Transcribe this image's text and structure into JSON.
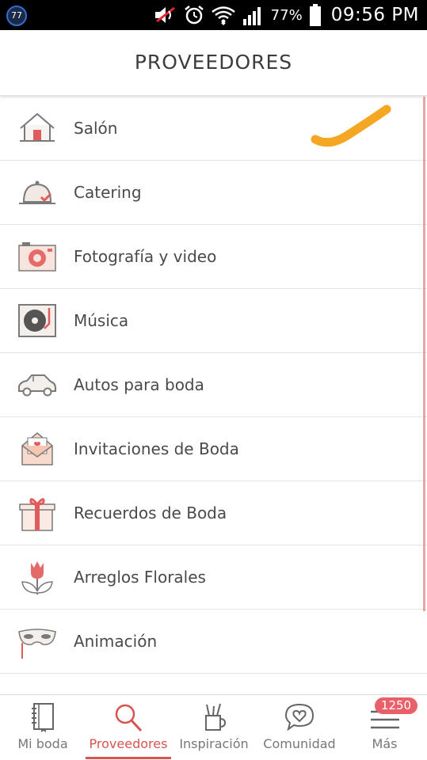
{
  "status_bar": {
    "notification_count": "77",
    "battery_percent": "77%",
    "time": "09:56 PM",
    "icons": [
      "muted-speaker-icon",
      "alarm-icon",
      "wifi-icon",
      "signal-icon",
      "battery-icon"
    ]
  },
  "header": {
    "title": "PROVEEDORES"
  },
  "list": {
    "items": [
      {
        "label": "Salón",
        "icon": "house-icon"
      },
      {
        "label": "Catering",
        "icon": "cloche-icon"
      },
      {
        "label": "Fotografía y video",
        "icon": "camera-icon"
      },
      {
        "label": "Música",
        "icon": "turntable-icon"
      },
      {
        "label": "Autos para boda",
        "icon": "car-icon"
      },
      {
        "label": "Invitaciones de Boda",
        "icon": "envelope-icon"
      },
      {
        "label": "Recuerdos de Boda",
        "icon": "gift-icon"
      },
      {
        "label": "Arreglos Florales",
        "icon": "tulip-icon"
      },
      {
        "label": "Animación",
        "icon": "mask-icon"
      }
    ]
  },
  "annotation": {
    "mark": "orange-checkmark",
    "color": "#f5a623"
  },
  "bottom_nav": {
    "tabs": [
      {
        "label": "Mi boda",
        "icon": "notebook-icon"
      },
      {
        "label": "Proveedores",
        "icon": "search-icon",
        "active": true
      },
      {
        "label": "Inspiración",
        "icon": "pencil-cup-icon"
      },
      {
        "label": "Comunidad",
        "icon": "heart-bubble-icon"
      },
      {
        "label": "Más",
        "icon": "menu-icon"
      }
    ],
    "badge": "1250"
  },
  "colors": {
    "accent": "#d9534f",
    "badge": "#e8606a",
    "status_bar": "#000000"
  }
}
